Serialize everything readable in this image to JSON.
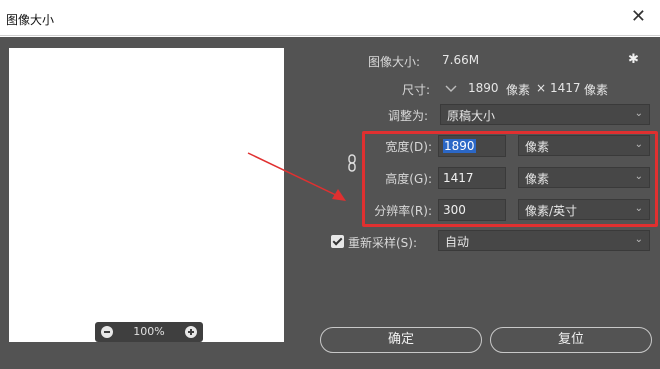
{
  "window": {
    "title": "图像大小",
    "close_glyph": "✕"
  },
  "preview": {
    "zoom_value": "100%"
  },
  "size_info": {
    "label": "图像大小:",
    "value": "7.66M",
    "settings_icon": "gear-icon"
  },
  "dimensions": {
    "label": "尺寸:",
    "width": "1890",
    "width_unit": "像素",
    "times": "×",
    "height": "1417",
    "height_unit": "像素"
  },
  "fit_to": {
    "label": "调整为:",
    "value": "原稿大小"
  },
  "width": {
    "label": "宽度(D):",
    "value": "1890",
    "unit": "像素"
  },
  "height": {
    "label": "高度(G):",
    "value": "1417",
    "unit": "像素"
  },
  "resolution": {
    "label": "分辨率(R):",
    "value": "300",
    "unit": "像素/英寸"
  },
  "resample": {
    "checked": true,
    "label": "重新采样(S):",
    "value": "自动"
  },
  "buttons": {
    "ok": "确定",
    "reset": "复位"
  },
  "annotation": {
    "box_color": "#e03030",
    "arrow_color": "#e03030"
  }
}
